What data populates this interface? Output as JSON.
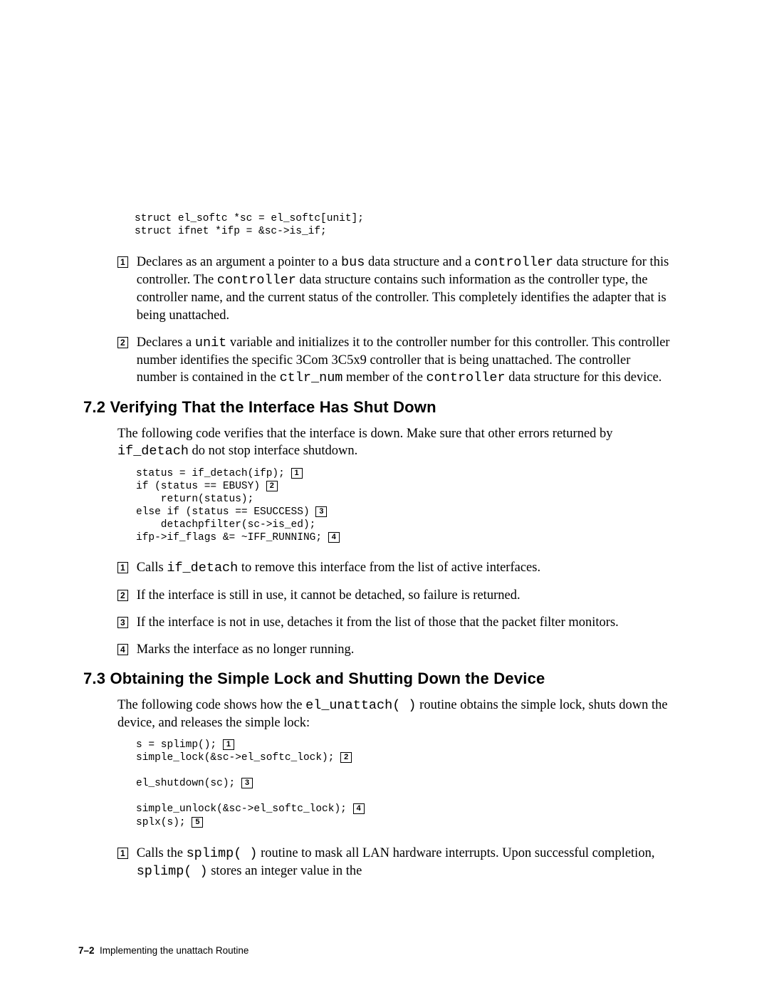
{
  "top_code": {
    "l1": "struct el_softc *sc = el_softc[unit];",
    "l2": "struct ifnet *ifp = &sc->is_if;"
  },
  "sec1": {
    "items": [
      {
        "num": "1",
        "pre": "Declares as an argument a pointer to a ",
        "c1": "bus",
        "mid1": " data structure and a ",
        "c2": "controller",
        "mid2": " data structure for this controller. The ",
        "c3": "controller",
        "tail": " data structure contains such information as the controller type, the controller name, and the current status of the controller. This completely identifies the adapter that is being unattached."
      },
      {
        "num": "2",
        "pre": "Declares a ",
        "c1": "unit",
        "mid1": " variable and initializes it to the controller number for this controller. This controller number identifies the specific 3Com 3C5x9 controller that is being unattached. The controller number is contained in the ",
        "c2": "ctlr_num",
        "mid2": " member of the ",
        "c3": "controller",
        "tail": " data structure for this device."
      }
    ]
  },
  "sec72": {
    "heading": "7.2 Verifying That the Interface Has Shut Down",
    "intro_pre": "The following code verifies that the interface is down. Make sure that other errors returned by ",
    "intro_code": "if_detach",
    "intro_post": " do not stop interface shutdown.",
    "code": {
      "l1a": "status = if_detach(ifp); ",
      "l1n": "1",
      "l2a": "if (status == EBUSY) ",
      "l2n": "2",
      "l3": "    return(status);",
      "l4a": "else if (status == ESUCCESS) ",
      "l4n": "3",
      "l5": "    detachpfilter(sc->is_ed);",
      "l6a": "ifp->if_flags &= ~IFF_RUNNING; ",
      "l6n": "4"
    },
    "items": [
      {
        "num": "1",
        "pre": "Calls ",
        "c1": "if_detach",
        "tail": " to remove this interface from the list of active interfaces."
      },
      {
        "num": "2",
        "text": "If the interface is still in use, it cannot be detached, so failure is returned."
      },
      {
        "num": "3",
        "text": "If the interface is not in use, detaches it from the list of those that the packet filter monitors."
      },
      {
        "num": "4",
        "text": "Marks the interface as no longer running."
      }
    ]
  },
  "sec73": {
    "heading": "7.3 Obtaining the Simple Lock and Shutting Down the Device",
    "intro_pre": "The following code shows how the ",
    "intro_code": "el_unattach( )",
    "intro_post": " routine obtains the simple lock, shuts down the device, and releases the simple lock:",
    "code": {
      "l1a": "s = splimp(); ",
      "l1n": "1",
      "l2a": "simple_lock(&sc->el_softc_lock); ",
      "l2n": "2",
      "l3a": "el_shutdown(sc); ",
      "l3n": "3",
      "l4a": "simple_unlock(&sc->el_softc_lock); ",
      "l4n": "4",
      "l5a": "splx(s); ",
      "l5n": "5"
    },
    "items": [
      {
        "num": "1",
        "pre": "Calls the ",
        "c1": "splimp( )",
        "mid": " routine to mask all LAN hardware interrupts. Upon successful completion, ",
        "c2": "splimp( )",
        "tail": " stores an integer value in the"
      }
    ]
  },
  "footer": {
    "page": "7–2",
    "title": "Implementing the unattach Routine"
  }
}
